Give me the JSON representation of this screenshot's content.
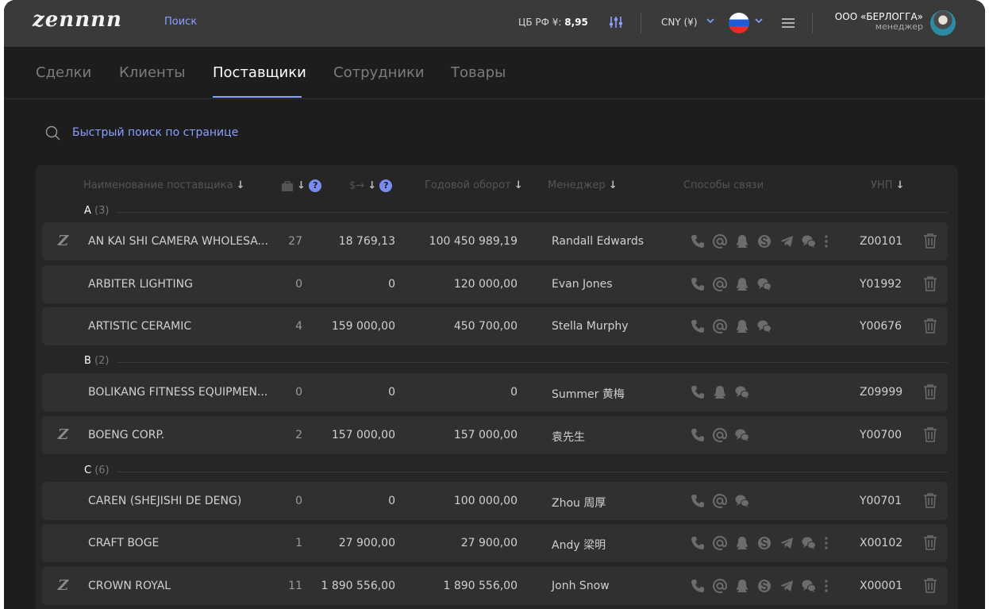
{
  "header": {
    "logo": "zennnn",
    "search_link": "Поиск",
    "rate_label": "ЦБ РФ ¥:",
    "rate_value": "8,95",
    "currency": "CNY (¥)",
    "company_name": "ООО «БЕРЛОГГА»",
    "company_role": "менеджер"
  },
  "tabs": [
    {
      "label": "Сделки"
    },
    {
      "label": "Клиенты"
    },
    {
      "label": "Поставщики",
      "active": true
    },
    {
      "label": "Сотрудники"
    },
    {
      "label": "Товары"
    }
  ],
  "quick_search": {
    "placeholder": "Быстрый поиск по странице"
  },
  "table": {
    "columns": {
      "name": "Наименование поставщика",
      "money": "$→",
      "turnover": "Годовой оборот",
      "manager": "Менеджер",
      "contacts": "Способы связи",
      "unp": "УНП"
    },
    "help_mark": "?",
    "groups": [
      {
        "letter": "A",
        "count": "(3)"
      },
      {
        "letter": "B",
        "count": "(2)"
      },
      {
        "letter": "C",
        "count": "(6)"
      }
    ],
    "rows": [
      {
        "z": "Z",
        "name": "AN KAI SHI CAMERA WHOLESA...",
        "orders": "27",
        "amount": "18 769,13",
        "turnover": "100 450 989,19",
        "manager": "Randall Edwards",
        "contacts": [
          "phone",
          "at",
          "qq",
          "skype",
          "telegram",
          "wechat",
          "more"
        ],
        "unp": "Z00101"
      },
      {
        "z": "",
        "name": "ARBITER LIGHTING",
        "orders": "0",
        "amount": "0",
        "turnover": "120 000,00",
        "manager": "Evan Jones",
        "contacts": [
          "phone",
          "at",
          "qq",
          "wechat"
        ],
        "unp": "Y01992"
      },
      {
        "z": "",
        "name": "ARTISTIC CERAMIC",
        "orders": "4",
        "amount": "159 000,00",
        "turnover": "450 700,00",
        "manager": "Stella Murphy",
        "contacts": [
          "phone",
          "at",
          "qq",
          "wechat"
        ],
        "unp": "Y00676"
      },
      {
        "z": "",
        "name": "BOLIKANG FITNESS EQUIPMEN...",
        "orders": "0",
        "amount": "0",
        "turnover": "0",
        "manager": "Summer 黄梅",
        "contacts": [
          "phone",
          "qq",
          "wechat"
        ],
        "unp": "Z09999"
      },
      {
        "z": "Z",
        "name": "BOENG CORP.",
        "orders": "2",
        "amount": "157 000,00",
        "turnover": "157 000,00",
        "manager": "袁先生",
        "contacts": [
          "phone",
          "at",
          "wechat"
        ],
        "unp": "Y00700"
      },
      {
        "z": "",
        "name": "CAREN (SHEJISHI DE DENG)",
        "orders": "0",
        "amount": "0",
        "turnover": "100 000,00",
        "manager": "Zhou 周厚",
        "contacts": [
          "phone",
          "at",
          "wechat"
        ],
        "unp": "Y00701"
      },
      {
        "z": "",
        "name": "CRAFT BOGE",
        "orders": "1",
        "amount": "27 900,00",
        "turnover": "27 900,00",
        "manager": "Andy 梁明",
        "contacts": [
          "phone",
          "at",
          "qq",
          "skype",
          "telegram",
          "wechat",
          "more"
        ],
        "unp": "X00102"
      },
      {
        "z": "Z",
        "name": "CROWN ROYAL",
        "orders": "11",
        "amount": "1 890 556,00",
        "turnover": "1 890 556,00",
        "manager": "Jonh Snow",
        "contacts": [
          "phone",
          "at",
          "qq",
          "skype",
          "telegram",
          "wechat",
          "more"
        ],
        "unp": "X00001"
      }
    ]
  },
  "colors": {
    "accent": "#8aa0ff",
    "background": "#1d1d1d",
    "topbar": "#3a3a3a",
    "row": "#303030"
  }
}
